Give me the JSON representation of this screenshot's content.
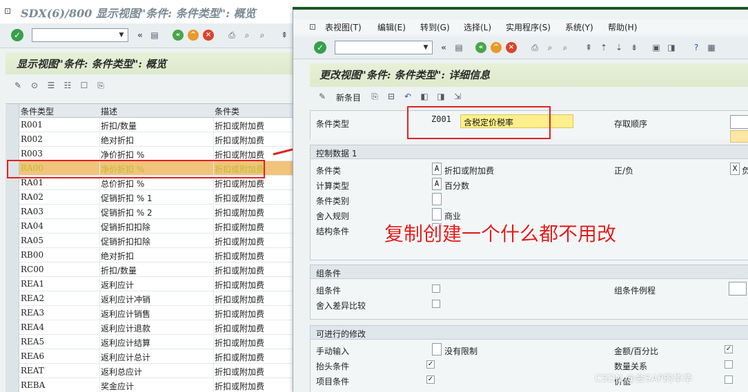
{
  "bg_window": {
    "title": "SDX(6)/800 显示视图\"条件: 条件类型\": 概览",
    "view_title": "显示视图\"条件: 条件类型\": 概览",
    "table": {
      "headers": [
        "条件类型",
        "描述",
        "条件类"
      ],
      "rows": [
        [
          "R001",
          "折扣/数量",
          "折扣或附加费"
        ],
        [
          "R002",
          "绝对折扣",
          "折扣或附加费"
        ],
        [
          "R003",
          "净价折扣 %",
          "折扣或附加费"
        ],
        [
          "RA00",
          "净价折扣 %",
          "折扣或附加费"
        ],
        [
          "RA01",
          "总价折扣 %",
          "折扣或附加费"
        ],
        [
          "RA02",
          "促销折扣 % 1",
          "折扣或附加费"
        ],
        [
          "RA03",
          "促销折扣 % 2",
          "折扣或附加费"
        ],
        [
          "RA04",
          "促销折扣扣除",
          "折扣或附加费"
        ],
        [
          "RA05",
          "促销折扣扣除",
          "折扣或附加费"
        ],
        [
          "RB00",
          "绝对折扣",
          "折扣或附加费"
        ],
        [
          "RC00",
          "折扣/数量",
          "折扣或附加费"
        ],
        [
          "REA1",
          "返利应计",
          "折扣或附加费"
        ],
        [
          "REA2",
          "返利应计冲销",
          "折扣或附加费"
        ],
        [
          "REA3",
          "返利应计销售",
          "折扣或附加费"
        ],
        [
          "REA4",
          "返利应计退款",
          "折扣或附加费"
        ],
        [
          "REA5",
          "返利应计结算",
          "折扣或附加费"
        ],
        [
          "REA6",
          "返利应计总计",
          "折扣或附加费"
        ],
        [
          "REAT",
          "返利总应计",
          "折扣或附加费"
        ],
        [
          "REBA",
          "奖金应计",
          "折扣或附加费"
        ]
      ],
      "highlighted_row": 3
    }
  },
  "fg_window": {
    "menu": [
      "表视图(T)",
      "编辑(E)",
      "转到(G)",
      "选择(L)",
      "实用程序(S)",
      "系统(Y)",
      "帮助(H)"
    ],
    "view_title": "更改视图\"条件: 条件类型\": 详细信息",
    "new_entries_label": "新条目",
    "cond_type_label": "条件类型",
    "cond_type_value": "Z001",
    "cond_type_desc": "含税定价税率",
    "access_seq_label": "存取顺序",
    "control_data": {
      "title": "控制数据 1",
      "cond_class_label": "条件类",
      "cond_class_value": "A",
      "cond_class_text": "折扣或附加费",
      "plus_minus_label": "正/负",
      "plus_minus_value": "X",
      "plus_minus_text": "负",
      "calc_type_label": "计算类型",
      "calc_type_value": "A",
      "calc_type_text": "百分数",
      "cond_category_label": "条件类别",
      "rounding_label": "舍入规则",
      "rounding_text": "商业",
      "structure_label": "结构条件"
    },
    "group_cond": {
      "title": "组条件",
      "group_cond_label": "组条件",
      "group_routine_label": "组条件例程",
      "round_diff_label": "舍入差异比较"
    },
    "changes": {
      "title": "可进行的修改",
      "manual_entry_label": "手动输入",
      "manual_entry_text": "没有限制",
      "amount_pct_label": "金额/百分比",
      "amount_pct_checked": true,
      "header_cond_label": "抬头条件",
      "header_cond_checked": true,
      "qty_relation_label": "数量关系",
      "qty_relation_checked": false,
      "item_cond_label": "项目条件",
      "item_cond_checked": true,
      "value_label": "价值",
      "value_checked": false
    }
  },
  "annotation_text": "复制创建一个什么都不用改",
  "watermark": "CSDN @会SAP的华华",
  "colors": {
    "highlight_row": "#f2c37c",
    "annotation_red": "#e01e1e",
    "header_green": "#e4edd3",
    "field_yellow": "#fdf08c"
  }
}
